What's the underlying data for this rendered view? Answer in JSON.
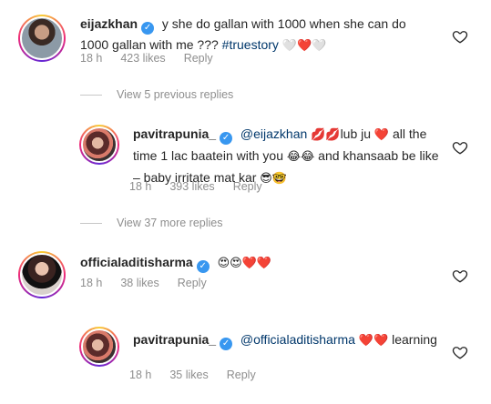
{
  "comments": [
    {
      "username": "eijazkhan",
      "text": "y she do gallan with 1000 when she can do 1000 gallan with me ???",
      "hashtag": "#truestory",
      "emojis": "🤍❤️🤍",
      "time": "18 h",
      "likes": "423 likes",
      "reply": "Reply"
    },
    {
      "username": "pavitrapunia_",
      "mention": "@eijazkhan",
      "emojis_a": "💋💋",
      "text_a": "lub ju",
      "emojis_b": "❤️",
      "text_b": "all the time 1 lac baatein with you",
      "emojis_c": "😂😂",
      "text_c": "and khansaab be like – baby irritate mat kar",
      "emojis_d": "😎🤓",
      "time": "18 h",
      "likes": "393 likes",
      "reply": "Reply"
    },
    {
      "username": "officialaditisharma",
      "emojis": "😍😍❤️❤️",
      "time": "18 h",
      "likes": "38 likes",
      "reply": "Reply"
    },
    {
      "username": "pavitrapunia_",
      "mention": "@officialaditisharma",
      "emojis": "❤️❤️",
      "text": "learning",
      "time": "18 h",
      "likes": "35 likes",
      "reply": "Reply"
    }
  ],
  "view_previous": "View 5 previous replies",
  "view_more": "View 37 more replies",
  "icons": {
    "verified": "verified-badge-icon",
    "like": "heart-outline-icon"
  },
  "colors": {
    "verified": "#3897f0",
    "mention": "#00376b",
    "meta": "#8e8e8e"
  }
}
